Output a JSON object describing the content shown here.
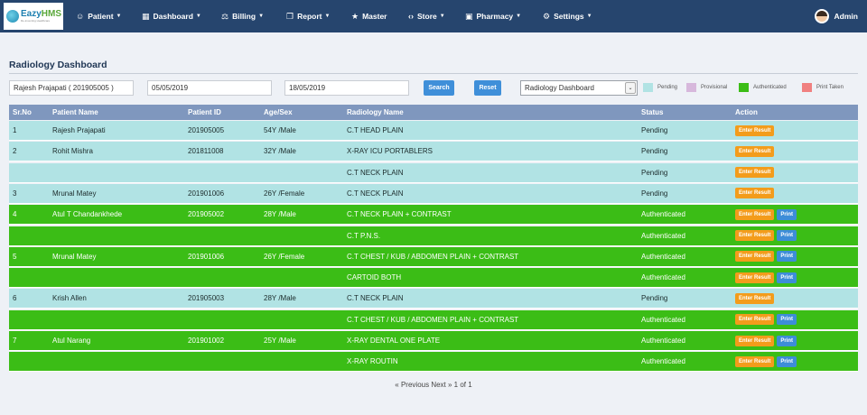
{
  "nav": {
    "logo_name_a": "Eazy",
    "logo_name_b": "HMS",
    "logo_tag": "Re-inventing Healthcare",
    "items": [
      {
        "label": "Patient",
        "icon": "user-icon",
        "caret": true
      },
      {
        "label": "Dashboard",
        "icon": "grid-icon",
        "caret": true
      },
      {
        "label": "Billing",
        "icon": "scale-icon",
        "caret": true
      },
      {
        "label": "Report",
        "icon": "document-icon",
        "caret": true
      },
      {
        "label": "Master",
        "icon": "star-icon",
        "caret": false
      },
      {
        "label": "Store",
        "icon": "code-icon",
        "caret": true
      },
      {
        "label": "Pharmacy",
        "icon": "briefcase-icon",
        "caret": true
      },
      {
        "label": "Settings",
        "icon": "gear-icon",
        "caret": true
      }
    ],
    "user": "Admin"
  },
  "page_title": "Radiology Dashboard",
  "filters": {
    "patient": "Rajesh Prajapati ( 201905005 )",
    "from_date": "05/05/2019",
    "to_date": "18/05/2019",
    "search_label": "Search",
    "reset_label": "Reset",
    "dashboard_select": "Radiology Dashboard"
  },
  "legend": [
    {
      "label": "Pending",
      "color": "#b1e3e4"
    },
    {
      "label": "Provisional",
      "color": "#d7b8dc"
    },
    {
      "label": "Authenticated",
      "color": "#3bbd16"
    },
    {
      "label": "Print Taken",
      "color": "#f08080"
    }
  ],
  "table": {
    "headers": [
      "Sr.No",
      "Patient Name",
      "Patient ID",
      "Age/Sex",
      "Radiology Name",
      "Status",
      "Action"
    ],
    "enter_label": "Enter Result",
    "print_label": "Print",
    "rows": [
      {
        "sr": "1",
        "name": "Rajesh Prajapati",
        "pid": "201905005",
        "age": "54Y /Male",
        "test": "C.T HEAD PLAIN",
        "status": "Pending"
      },
      {
        "sr": "2",
        "name": "Rohit Mishra",
        "pid": "201811008",
        "age": "32Y /Male",
        "test": "X-RAY ICU PORTABLERS",
        "status": "Pending"
      },
      {
        "sr": "",
        "name": "",
        "pid": "",
        "age": "",
        "test": "C.T NECK PLAIN",
        "status": "Pending"
      },
      {
        "sr": "3",
        "name": "Mrunal Matey",
        "pid": "201901006",
        "age": "26Y /Female",
        "test": "C.T NECK PLAIN",
        "status": "Pending"
      },
      {
        "sr": "4",
        "name": "Atul T Chandankhede",
        "pid": "201905002",
        "age": "28Y /Male",
        "test": "C.T NECK PLAIN + CONTRAST",
        "status": "Authenticated"
      },
      {
        "sr": "",
        "name": "",
        "pid": "",
        "age": "",
        "test": "C.T P.N.S.",
        "status": "Authenticated"
      },
      {
        "sr": "5",
        "name": "Mrunal Matey",
        "pid": "201901006",
        "age": "26Y /Female",
        "test": "C.T CHEST / KUB / ABDOMEN PLAIN + CONTRAST",
        "status": "Authenticated"
      },
      {
        "sr": "",
        "name": "",
        "pid": "",
        "age": "",
        "test": "CARTOID BOTH",
        "status": "Authenticated"
      },
      {
        "sr": "6",
        "name": "Krish Allen",
        "pid": "201905003",
        "age": "28Y /Male",
        "test": "C.T NECK PLAIN",
        "status": "Pending"
      },
      {
        "sr": "",
        "name": "",
        "pid": "",
        "age": "",
        "test": "C.T CHEST / KUB / ABDOMEN PLAIN + CONTRAST",
        "status": "Authenticated"
      },
      {
        "sr": "7",
        "name": "Atul Narang",
        "pid": "201901002",
        "age": "25Y /Male",
        "test": "X-RAY DENTAL ONE PLATE",
        "status": "Authenticated"
      },
      {
        "sr": "",
        "name": "",
        "pid": "",
        "age": "",
        "test": "X-RAY ROUTIN",
        "status": "Authenticated"
      }
    ]
  },
  "pager": "« Previous Next » 1 of 1"
}
